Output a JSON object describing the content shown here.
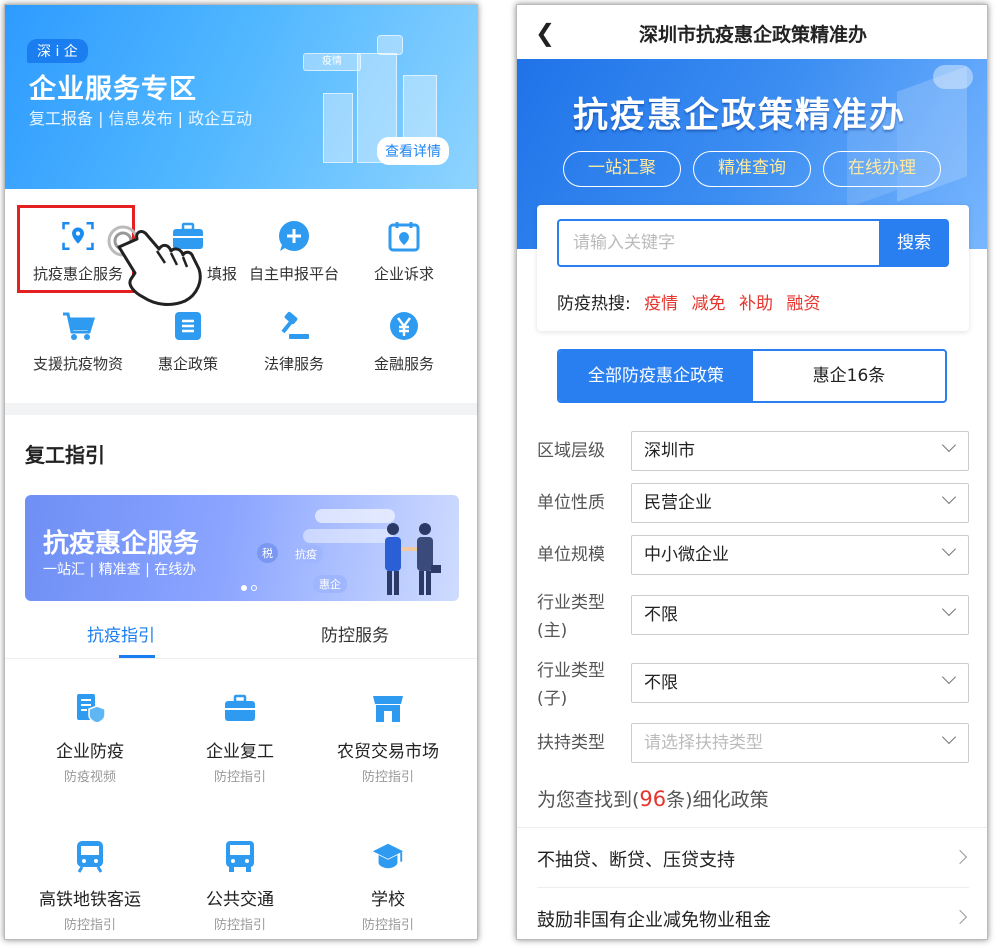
{
  "left": {
    "banner": {
      "brand": "深 i 企",
      "title": "企业服务专区",
      "subtitle": "复工报备 | 信息发布 | 政企互动",
      "detail_button": "查看详情",
      "badge": "疫情"
    },
    "grid": [
      {
        "label": "抗疫惠企服务",
        "icon": "location-scan-icon"
      },
      {
        "label": "填报",
        "icon": "briefcase-icon"
      },
      {
        "label": "自主申报平台",
        "icon": "plus-chat-icon"
      },
      {
        "label": "企业诉求",
        "icon": "calendar-pin-icon"
      },
      {
        "label": "支援抗疫物资",
        "icon": "cart-icon"
      },
      {
        "label": "惠企政策",
        "icon": "document-icon"
      },
      {
        "label": "法律服务",
        "icon": "gavel-icon"
      },
      {
        "label": "金融服务",
        "icon": "yuan-icon"
      }
    ],
    "section_title": "复工指引",
    "promo": {
      "title": "抗疫惠企服务",
      "subtitle": "一站汇 | 精准查 | 在线办",
      "tag1": "抗疫",
      "tag2": "惠企",
      "tag3": "税"
    },
    "tabs": [
      "抗疫指引",
      "防控服务"
    ],
    "services": [
      {
        "name": "企业防疫",
        "sub": "防疫视频",
        "icon": "shield-building-icon"
      },
      {
        "name": "企业复工",
        "sub": "防控指引",
        "icon": "briefcase-icon"
      },
      {
        "name": "农贸交易市场",
        "sub": "防控指引",
        "icon": "shop-icon"
      },
      {
        "name": "高铁地铁客运",
        "sub": "防控指引",
        "icon": "train-icon"
      },
      {
        "name": "公共交通",
        "sub": "防控指引",
        "icon": "bus-icon"
      },
      {
        "name": "学校",
        "sub": "防控指引",
        "icon": "graduation-cap-icon"
      }
    ]
  },
  "right": {
    "nav_title": "深圳市抗疫惠企政策精准办",
    "banner_title": "抗疫惠企政策精准办",
    "pills": [
      "一站汇聚",
      "精准查询",
      "在线办理"
    ],
    "search": {
      "placeholder": "请输入关键字",
      "button": "搜索",
      "hot_label": "防疫热搜:",
      "hot_keywords": [
        "疫情",
        "减免",
        "补助",
        "融资"
      ]
    },
    "segments": [
      "全部防疫惠企政策",
      "惠企16条"
    ],
    "filters": [
      {
        "label": "区域层级",
        "value": "深圳市",
        "placeholder": false
      },
      {
        "label": "单位性质",
        "value": "民营企业",
        "placeholder": false
      },
      {
        "label": "单位规模",
        "value": "中小微企业",
        "placeholder": false
      },
      {
        "label": "行业类型(主)",
        "value": "不限",
        "placeholder": false
      },
      {
        "label": "行业类型(子)",
        "value": "不限",
        "placeholder": false
      },
      {
        "label": "扶持类型",
        "value": "请选择扶持类型",
        "placeholder": true
      }
    ],
    "found": {
      "prefix": "为您查找到(",
      "count": "96",
      "suffix": "条)细化政策"
    },
    "policies": [
      "不抽贷、断贷、压贷支持",
      "鼓励非国有企业减免物业租金"
    ]
  },
  "colors": {
    "accent": "#2a7ff0",
    "hot": "#e5342d",
    "highlight_box": "#e52020"
  }
}
